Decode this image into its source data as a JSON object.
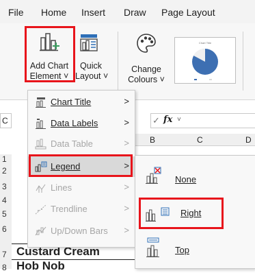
{
  "ribbon_tabs": [
    "File",
    "Home",
    "Insert",
    "Draw",
    "Page Layout"
  ],
  "ribbon": {
    "add_chart_element": {
      "line1": "Add Chart",
      "line2": "Element ˅"
    },
    "quick_layout": {
      "line1": "Quick",
      "line2": "Layout ˅"
    },
    "change_colours": {
      "line1": "Change",
      "line2": "Colours ˅"
    },
    "chart_thumb_title": "Chart Title"
  },
  "formula_bar": {
    "namebox_fragment": "C",
    "fx": "fx"
  },
  "columns": [
    "B",
    "C",
    "D"
  ],
  "rows": [
    "1",
    "2",
    "3",
    "4",
    "5",
    "6",
    "7",
    "8"
  ],
  "cells": {
    "row7": "Custard Cream",
    "row8": "Hob Nob"
  },
  "menu": {
    "items": [
      {
        "label": "Chart Title",
        "disabled": false,
        "arrow": ">"
      },
      {
        "label": "Data Labels",
        "disabled": false,
        "arrow": ">"
      },
      {
        "label": "Data Table",
        "disabled": true,
        "arrow": ">"
      },
      {
        "label": "Legend",
        "disabled": false,
        "arrow": ">",
        "active": true
      },
      {
        "label": "Lines",
        "disabled": true,
        "arrow": ">"
      },
      {
        "label": "Trendline",
        "disabled": true,
        "arrow": ">"
      },
      {
        "label": "Up/Down Bars",
        "disabled": true,
        "arrow": ">"
      }
    ]
  },
  "submenu": {
    "items": [
      {
        "label": "None"
      },
      {
        "label": "Right",
        "highlighted": true
      },
      {
        "label": "Top"
      }
    ]
  },
  "colors": {
    "highlight_border": "#e8141b",
    "accent_green": "#3a9e5f",
    "accent_blue": "#2e6fb7",
    "pie_blue": "#3d6fb2"
  }
}
